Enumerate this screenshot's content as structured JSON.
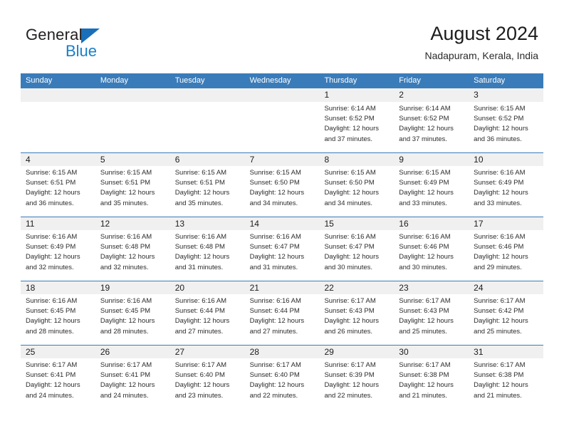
{
  "logo": {
    "word_top": "General",
    "word_bottom": "Blue",
    "triangle_color": "#1a6fba",
    "blue_color": "#1a7ec8",
    "dark_color": "#231f20"
  },
  "header": {
    "title": "August 2024",
    "location": "Nadapuram, Kerala, India"
  },
  "theme": {
    "header_bar": "#3a7cba",
    "daynum_band": "#f0f0f0",
    "separator": "#3a7cba",
    "text": "#2b2b2b"
  },
  "day_headers": [
    "Sunday",
    "Monday",
    "Tuesday",
    "Wednesday",
    "Thursday",
    "Friday",
    "Saturday"
  ],
  "weeks": [
    [
      {
        "day": "",
        "sunrise": "",
        "sunset": "",
        "daylight": ""
      },
      {
        "day": "",
        "sunrise": "",
        "sunset": "",
        "daylight": ""
      },
      {
        "day": "",
        "sunrise": "",
        "sunset": "",
        "daylight": ""
      },
      {
        "day": "",
        "sunrise": "",
        "sunset": "",
        "daylight": ""
      },
      {
        "day": "1",
        "sunrise": "Sunrise: 6:14 AM",
        "sunset": "Sunset: 6:52 PM",
        "daylight": "Daylight: 12 hours and 37 minutes."
      },
      {
        "day": "2",
        "sunrise": "Sunrise: 6:14 AM",
        "sunset": "Sunset: 6:52 PM",
        "daylight": "Daylight: 12 hours and 37 minutes."
      },
      {
        "day": "3",
        "sunrise": "Sunrise: 6:15 AM",
        "sunset": "Sunset: 6:52 PM",
        "daylight": "Daylight: 12 hours and 36 minutes."
      }
    ],
    [
      {
        "day": "4",
        "sunrise": "Sunrise: 6:15 AM",
        "sunset": "Sunset: 6:51 PM",
        "daylight": "Daylight: 12 hours and 36 minutes."
      },
      {
        "day": "5",
        "sunrise": "Sunrise: 6:15 AM",
        "sunset": "Sunset: 6:51 PM",
        "daylight": "Daylight: 12 hours and 35 minutes."
      },
      {
        "day": "6",
        "sunrise": "Sunrise: 6:15 AM",
        "sunset": "Sunset: 6:51 PM",
        "daylight": "Daylight: 12 hours and 35 minutes."
      },
      {
        "day": "7",
        "sunrise": "Sunrise: 6:15 AM",
        "sunset": "Sunset: 6:50 PM",
        "daylight": "Daylight: 12 hours and 34 minutes."
      },
      {
        "day": "8",
        "sunrise": "Sunrise: 6:15 AM",
        "sunset": "Sunset: 6:50 PM",
        "daylight": "Daylight: 12 hours and 34 minutes."
      },
      {
        "day": "9",
        "sunrise": "Sunrise: 6:15 AM",
        "sunset": "Sunset: 6:49 PM",
        "daylight": "Daylight: 12 hours and 33 minutes."
      },
      {
        "day": "10",
        "sunrise": "Sunrise: 6:16 AM",
        "sunset": "Sunset: 6:49 PM",
        "daylight": "Daylight: 12 hours and 33 minutes."
      }
    ],
    [
      {
        "day": "11",
        "sunrise": "Sunrise: 6:16 AM",
        "sunset": "Sunset: 6:49 PM",
        "daylight": "Daylight: 12 hours and 32 minutes."
      },
      {
        "day": "12",
        "sunrise": "Sunrise: 6:16 AM",
        "sunset": "Sunset: 6:48 PM",
        "daylight": "Daylight: 12 hours and 32 minutes."
      },
      {
        "day": "13",
        "sunrise": "Sunrise: 6:16 AM",
        "sunset": "Sunset: 6:48 PM",
        "daylight": "Daylight: 12 hours and 31 minutes."
      },
      {
        "day": "14",
        "sunrise": "Sunrise: 6:16 AM",
        "sunset": "Sunset: 6:47 PM",
        "daylight": "Daylight: 12 hours and 31 minutes."
      },
      {
        "day": "15",
        "sunrise": "Sunrise: 6:16 AM",
        "sunset": "Sunset: 6:47 PM",
        "daylight": "Daylight: 12 hours and 30 minutes."
      },
      {
        "day": "16",
        "sunrise": "Sunrise: 6:16 AM",
        "sunset": "Sunset: 6:46 PM",
        "daylight": "Daylight: 12 hours and 30 minutes."
      },
      {
        "day": "17",
        "sunrise": "Sunrise: 6:16 AM",
        "sunset": "Sunset: 6:46 PM",
        "daylight": "Daylight: 12 hours and 29 minutes."
      }
    ],
    [
      {
        "day": "18",
        "sunrise": "Sunrise: 6:16 AM",
        "sunset": "Sunset: 6:45 PM",
        "daylight": "Daylight: 12 hours and 28 minutes."
      },
      {
        "day": "19",
        "sunrise": "Sunrise: 6:16 AM",
        "sunset": "Sunset: 6:45 PM",
        "daylight": "Daylight: 12 hours and 28 minutes."
      },
      {
        "day": "20",
        "sunrise": "Sunrise: 6:16 AM",
        "sunset": "Sunset: 6:44 PM",
        "daylight": "Daylight: 12 hours and 27 minutes."
      },
      {
        "day": "21",
        "sunrise": "Sunrise: 6:16 AM",
        "sunset": "Sunset: 6:44 PM",
        "daylight": "Daylight: 12 hours and 27 minutes."
      },
      {
        "day": "22",
        "sunrise": "Sunrise: 6:17 AM",
        "sunset": "Sunset: 6:43 PM",
        "daylight": "Daylight: 12 hours and 26 minutes."
      },
      {
        "day": "23",
        "sunrise": "Sunrise: 6:17 AM",
        "sunset": "Sunset: 6:43 PM",
        "daylight": "Daylight: 12 hours and 25 minutes."
      },
      {
        "day": "24",
        "sunrise": "Sunrise: 6:17 AM",
        "sunset": "Sunset: 6:42 PM",
        "daylight": "Daylight: 12 hours and 25 minutes."
      }
    ],
    [
      {
        "day": "25",
        "sunrise": "Sunrise: 6:17 AM",
        "sunset": "Sunset: 6:41 PM",
        "daylight": "Daylight: 12 hours and 24 minutes."
      },
      {
        "day": "26",
        "sunrise": "Sunrise: 6:17 AM",
        "sunset": "Sunset: 6:41 PM",
        "daylight": "Daylight: 12 hours and 24 minutes."
      },
      {
        "day": "27",
        "sunrise": "Sunrise: 6:17 AM",
        "sunset": "Sunset: 6:40 PM",
        "daylight": "Daylight: 12 hours and 23 minutes."
      },
      {
        "day": "28",
        "sunrise": "Sunrise: 6:17 AM",
        "sunset": "Sunset: 6:40 PM",
        "daylight": "Daylight: 12 hours and 22 minutes."
      },
      {
        "day": "29",
        "sunrise": "Sunrise: 6:17 AM",
        "sunset": "Sunset: 6:39 PM",
        "daylight": "Daylight: 12 hours and 22 minutes."
      },
      {
        "day": "30",
        "sunrise": "Sunrise: 6:17 AM",
        "sunset": "Sunset: 6:38 PM",
        "daylight": "Daylight: 12 hours and 21 minutes."
      },
      {
        "day": "31",
        "sunrise": "Sunrise: 6:17 AM",
        "sunset": "Sunset: 6:38 PM",
        "daylight": "Daylight: 12 hours and 21 minutes."
      }
    ]
  ]
}
